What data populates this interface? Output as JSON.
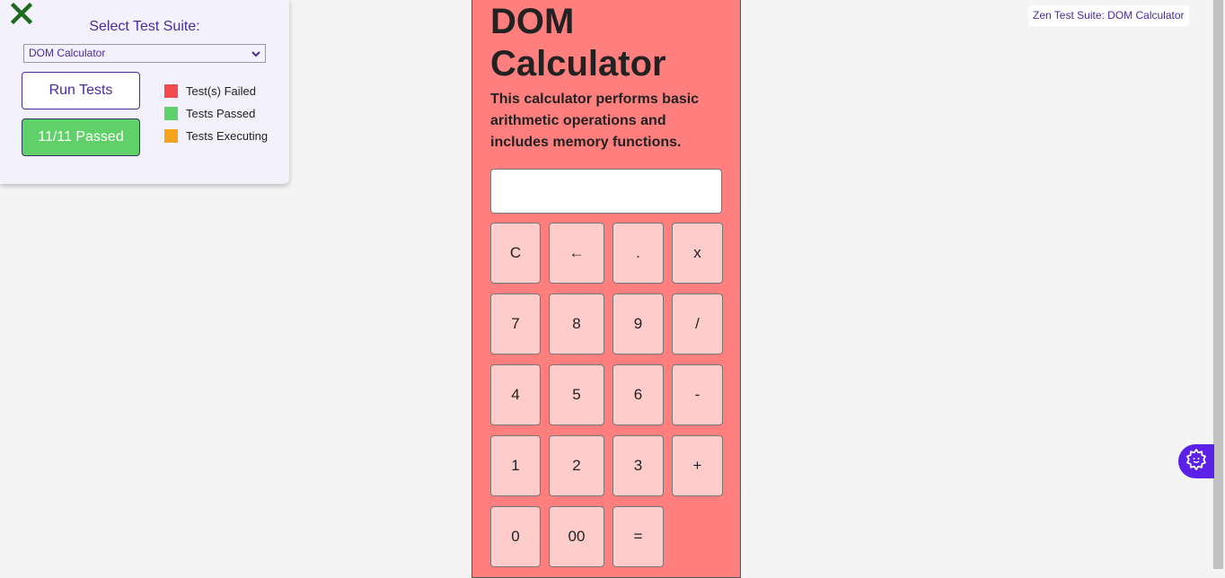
{
  "test_panel": {
    "suite_label": "Select Test Suite:",
    "selected_suite": "DOM Calculator",
    "run_button": "Run Tests",
    "result_button": "11/11 Passed",
    "legend": [
      {
        "label": "Test(s) Failed",
        "color": "#f44b4f"
      },
      {
        "label": "Tests Passed",
        "color": "#5fd168"
      },
      {
        "label": "Tests Executing",
        "color": "#f7a31c"
      }
    ],
    "close_icon": "close-x-icon"
  },
  "badge": {
    "text": "Zen Test Suite: DOM Calculator"
  },
  "calculator": {
    "title": "DOM Calculator",
    "description": "This calculator performs basic arithmetic operations and includes memory functions.",
    "display_value": "",
    "keys": [
      "C",
      "←",
      ".",
      "x",
      "7",
      "8",
      "9",
      "/",
      "4",
      "5",
      "6",
      "-",
      "1",
      "2",
      "3",
      "+",
      "0",
      "00",
      "="
    ]
  },
  "settings_button": {
    "icon": "gear-icon"
  },
  "colors": {
    "accent": "#4b2aa0",
    "calculator_bg": "#ff7f7f",
    "key_bg": "#ffcccc",
    "fab_bg": "#5b21e6"
  }
}
